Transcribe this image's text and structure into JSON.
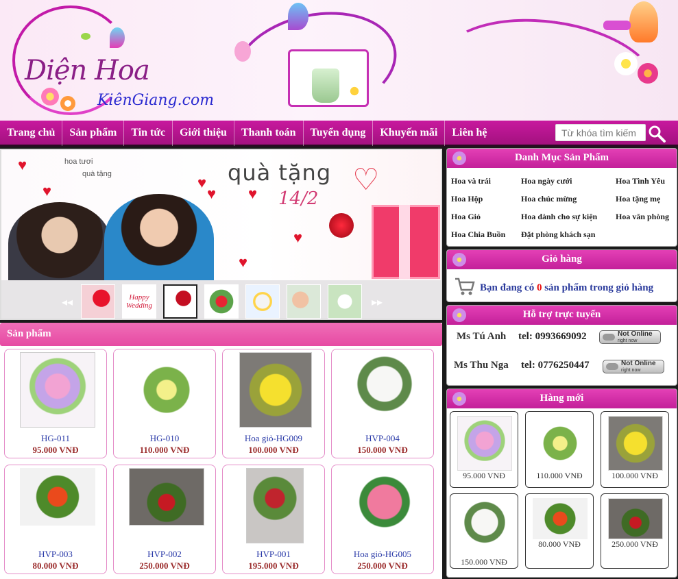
{
  "header": {
    "logo_line1": "Diện Hoa",
    "logo_line2": "KiênGiang.com"
  },
  "nav": {
    "items": [
      "Trang chủ",
      "Sản phẩm",
      "Tin tức",
      "Giới thiệu",
      "Thanh toán",
      "Tuyển dụng",
      "Khuyến mãi",
      "Liên hệ"
    ],
    "search_placeholder": "Từ khóa tìm kiếm"
  },
  "slider": {
    "tag_line1": "hoa tươi",
    "tag_line2": "quà tặng",
    "title": "quà tặng",
    "date": "14/2",
    "prev_arrow": "◂◂",
    "next_arrow": "▸▸",
    "thumb_text": "Happy Wedding"
  },
  "products": {
    "header": "Sản phẩm",
    "items": [
      {
        "name": "HG-011",
        "price": "95.000 VNĐ"
      },
      {
        "name": "HG-010",
        "price": "110.000 VNĐ"
      },
      {
        "name": "Hoa giỏ-HG009",
        "price": "100.000 VNĐ"
      },
      {
        "name": "HVP-004",
        "price": "150.000 VNĐ"
      },
      {
        "name": "HVP-003",
        "price": "80.000 VNĐ"
      },
      {
        "name": "HVP-002",
        "price": "250.000 VNĐ"
      },
      {
        "name": "HVP-001",
        "price": "195.000 VNĐ"
      },
      {
        "name": "Hoa giỏ-HG005",
        "price": "250.000 VNĐ"
      }
    ]
  },
  "categories": {
    "header": "Danh Mục Sản Phẩm",
    "items": [
      "Hoa và trái",
      "Hoa ngày cưới",
      "Hoa Tình Yêu",
      "Hoa Hộp",
      "Hoa chúc mừng",
      "Hoa tặng mẹ",
      "Hoa Giỏ",
      "Hoa dành cho sự kiện",
      "Hoa văn phòng",
      "Hoa Chia Buồn",
      "Đặt phòng khách sạn"
    ]
  },
  "cart": {
    "header": "Giỏ hàng",
    "text_before": "Bạn đang có ",
    "count": "0",
    "text_after": " sản phẩm trong giỏ hàng"
  },
  "support": {
    "header": "Hỗ trợ trực tuyến",
    "agents": [
      {
        "name": "Ms Tú Anh",
        "tel": "tel: 0993669092",
        "status": "Not Online",
        "status_sub": "right now"
      },
      {
        "name": "Ms Thu Nga",
        "tel": "tel: 0776250447",
        "status": "Not Online",
        "status_sub": "right now"
      }
    ]
  },
  "new_items": {
    "header": "Hàng mới",
    "prices": [
      "95.000 VNĐ",
      "110.000 VNĐ",
      "100.000 VNĐ",
      "150.000 VNĐ",
      "80.000 VNĐ",
      "250.000 VNĐ"
    ]
  },
  "colors": {
    "brand": "#c8199e",
    "price": "#9b2c2c",
    "link": "#2a3aa8"
  }
}
